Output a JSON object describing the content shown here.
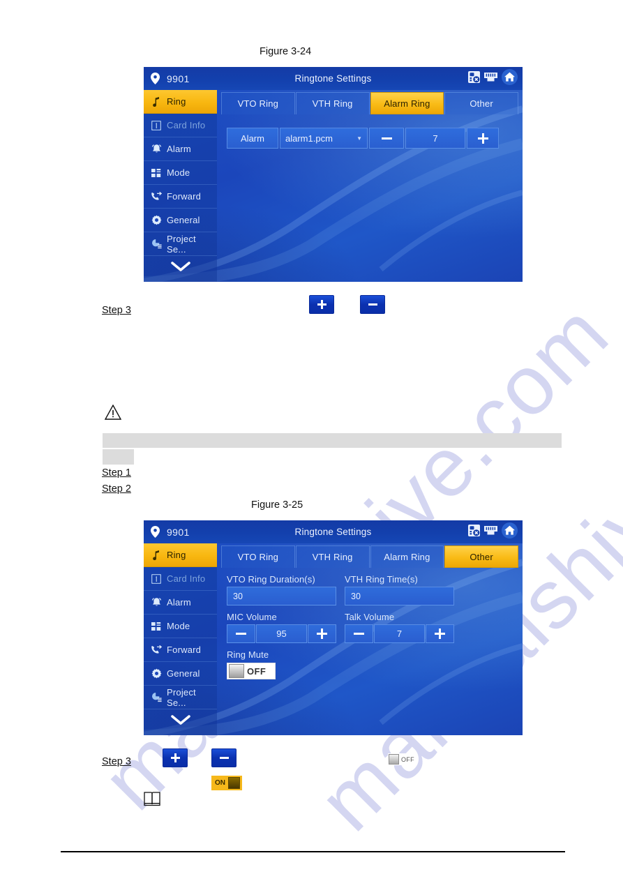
{
  "document": {
    "figure_1_caption": "Figure 3-24",
    "figure_2_caption": "Figure 3-25",
    "step_3_a": "Step 3",
    "step_1": "Step 1",
    "step_2": "Step 2",
    "step_3_b": "Step 3",
    "watermark_text": "manualshive.com",
    "icons": {
      "warning": "warning-triangle-icon",
      "note": "note-book-icon"
    },
    "inline_buttons": {
      "plus_label": "+",
      "minus_label": "-",
      "toggle_on_label": "ON",
      "toggle_off_label": "OFF"
    }
  },
  "device_1": {
    "header": {
      "room_number": "9901",
      "title": "Ringtone Settings",
      "icons": [
        "sd-card-eject-icon",
        "network-port-icon",
        "home-icon"
      ],
      "location_icon": "location-pin-icon"
    },
    "sidebar": {
      "items": [
        {
          "label": "Ring",
          "icon": "music-note-icon",
          "state": "active"
        },
        {
          "label": "Card Info",
          "icon": "card-icon",
          "state": "disabled"
        },
        {
          "label": "Alarm",
          "icon": "bell-icon",
          "state": "normal"
        },
        {
          "label": "Mode",
          "icon": "grid-icon",
          "state": "normal"
        },
        {
          "label": "Forward",
          "icon": "call-forward-icon",
          "state": "normal"
        },
        {
          "label": "General",
          "icon": "gear-icon",
          "state": "normal"
        },
        {
          "label": "Project Se...",
          "icon": "project-settings-icon",
          "state": "normal"
        }
      ],
      "more_icon": "chevron-down-icon"
    },
    "tabs": [
      {
        "label": "VTO Ring",
        "active": false
      },
      {
        "label": "VTH Ring",
        "active": false
      },
      {
        "label": "Alarm Ring",
        "active": true
      },
      {
        "label": "Other",
        "active": false
      }
    ],
    "alarm_row": {
      "name": "Alarm",
      "ringtone_file": "alarm1.pcm",
      "dropdown_icon": "caret-down-icon",
      "minus_icon": "minus-icon",
      "volume": "7",
      "plus_icon": "plus-icon"
    }
  },
  "device_2": {
    "header": {
      "room_number": "9901",
      "title": "Ringtone Settings",
      "icons": [
        "sd-card-eject-icon",
        "network-port-icon",
        "home-icon"
      ],
      "location_icon": "location-pin-icon"
    },
    "sidebar": {
      "items": [
        {
          "label": "Ring",
          "icon": "music-note-icon",
          "state": "active"
        },
        {
          "label": "Card Info",
          "icon": "card-icon",
          "state": "disabled"
        },
        {
          "label": "Alarm",
          "icon": "bell-icon",
          "state": "normal"
        },
        {
          "label": "Mode",
          "icon": "grid-icon",
          "state": "normal"
        },
        {
          "label": "Forward",
          "icon": "call-forward-icon",
          "state": "normal"
        },
        {
          "label": "General",
          "icon": "gear-icon",
          "state": "normal"
        },
        {
          "label": "Project Se...",
          "icon": "project-settings-icon",
          "state": "normal"
        }
      ],
      "more_icon": "chevron-down-icon"
    },
    "tabs": [
      {
        "label": "VTO Ring",
        "active": false
      },
      {
        "label": "VTH Ring",
        "active": false
      },
      {
        "label": "Alarm Ring",
        "active": false
      },
      {
        "label": "Other",
        "active": true
      }
    ],
    "fields": {
      "vto_ring_duration_label": "VTO Ring Duration(s)",
      "vto_ring_duration_value": "30",
      "vth_ring_time_label": "VTH Ring Time(s)",
      "vth_ring_time_value": "30",
      "mic_volume_label": "MIC Volume",
      "mic_volume_value": "95",
      "talk_volume_label": "Talk Volume",
      "talk_volume_value": "7",
      "ring_mute_label": "Ring Mute",
      "ring_mute_state": "OFF"
    }
  },
  "colors": {
    "accent_yellow": "#f8b710",
    "screen_blue": "#1f52c6",
    "header_blue": "#1340ad",
    "doc_button_blue": "#0b31b0",
    "gray_bar": "#dcdcdc",
    "watermark": "#cdd0ef"
  }
}
